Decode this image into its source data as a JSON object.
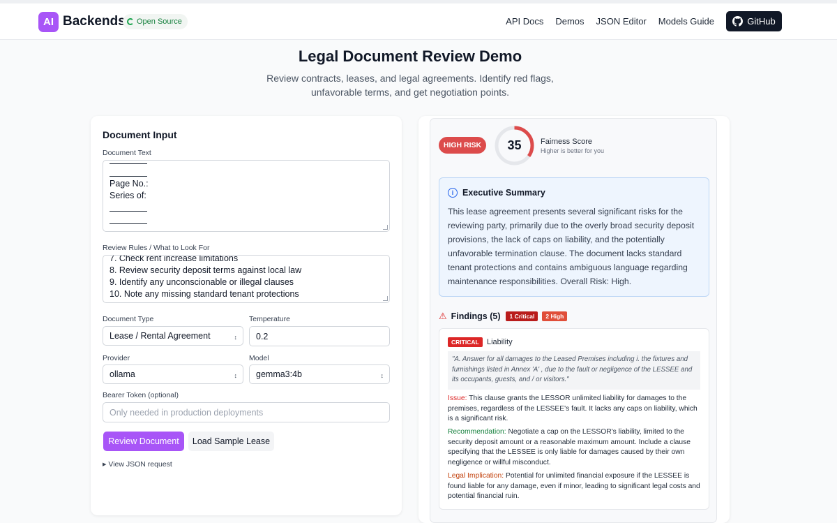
{
  "nav": {
    "logo": "AI",
    "brand": "Backends",
    "badge": "Open Source",
    "links": [
      "API Docs",
      "Demos",
      "JSON Editor",
      "Models Guide"
    ],
    "github": "GitHub",
    "icons": {
      "badge": "spinner-icon",
      "github": "github-icon"
    }
  },
  "header": {
    "title": "Legal Document Review Demo",
    "subtitle": "Review contracts, leases, and legal agreements. Identify red flags, unfavorable terms, and get negotiation points."
  },
  "input": {
    "heading": "Document Input",
    "doc_text_label": "Document Text",
    "doc_text_lines": [
      "Page No.:",
      "Series of:"
    ],
    "rules_label": "Review Rules / What to Look For",
    "rules_lines": [
      "7. Check rent increase limitations",
      "8. Review security deposit terms against local law",
      "9. Identify any unconscionable or illegal clauses",
      "10. Note any missing standard tenant protections"
    ],
    "doc_type_label": "Document Type",
    "doc_type_value": "Lease / Rental Agreement",
    "temperature_label": "Temperature",
    "temperature_value": "0.2",
    "provider_label": "Provider",
    "provider_value": "ollama",
    "model_label": "Model",
    "model_value": "gemma3:4b",
    "token_label": "Bearer Token (optional)",
    "token_placeholder": "Only needed in production deployments",
    "review_button": "Review Document",
    "sample_button": "Load Sample Lease",
    "json_toggle": "View JSON request"
  },
  "result": {
    "risk_level": "HIGH RISK",
    "fairness_score": 35,
    "fairness_max": 100,
    "fairness_title": "Fairness Score",
    "fairness_sub": "Higher is better for you",
    "colors": {
      "gauge": "#dc4b4b",
      "gauge_track": "#e5e7eb",
      "accent": "#a855f7"
    },
    "summary_title": "Executive Summary",
    "summary_text": "This lease agreement presents several significant risks for the reviewing party, primarily due to the overly broad security deposit provisions, the lack of caps on liability, and the potentially unfavorable termination clause. The document lacks standard tenant protections and contains ambiguous language regarding maintenance responsibilities. Overall Risk: High.",
    "findings_title": "Findings (5)",
    "findings_tags": [
      "1 Critical",
      "2 High"
    ],
    "finding": {
      "severity": "CRITICAL",
      "category": "Liability",
      "quote": "\"A. Answer for all damages to the Leased Premises including i. the fixtures and furnishings listed in Annex 'A' , due to the fault or negligence of the LESSEE and its occupants, guests, and / or visitors.\"",
      "issue_label": "Issue:",
      "issue": "This clause grants the LESSOR unlimited liability for damages to the premises, regardless of the LESSEE's fault. It lacks any caps on liability, which is a significant risk.",
      "rec_label": "Recommendation:",
      "rec": "Negotiate a cap on the LESSOR's liability, limited to the security deposit amount or a reasonable maximum amount. Include a clause specifying that the LESSEE is only liable for damages caused by their own negligence or willful misconduct.",
      "legal_label": "Legal Implication:",
      "legal": "Potential for unlimited financial exposure if the LESSEE is found liable for any damage, even if minor, leading to significant legal costs and potential financial ruin."
    }
  }
}
